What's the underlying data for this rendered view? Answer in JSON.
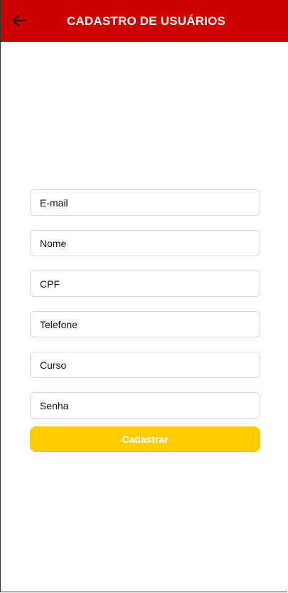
{
  "header": {
    "title": "CADASTRO DE USUÁRIOS",
    "back_icon": "arrow-left-icon"
  },
  "form": {
    "fields": [
      {
        "placeholder": "E-mail",
        "value": ""
      },
      {
        "placeholder": "Nome",
        "value": ""
      },
      {
        "placeholder": "CPF",
        "value": ""
      },
      {
        "placeholder": "Telefone",
        "value": ""
      },
      {
        "placeholder": "Curso",
        "value": ""
      },
      {
        "placeholder": "Senha",
        "value": ""
      }
    ],
    "submit_label": "Cadastrar"
  },
  "colors": {
    "header": "#cc0000",
    "button": "#ffcc00",
    "button_text": "#ffffff"
  }
}
